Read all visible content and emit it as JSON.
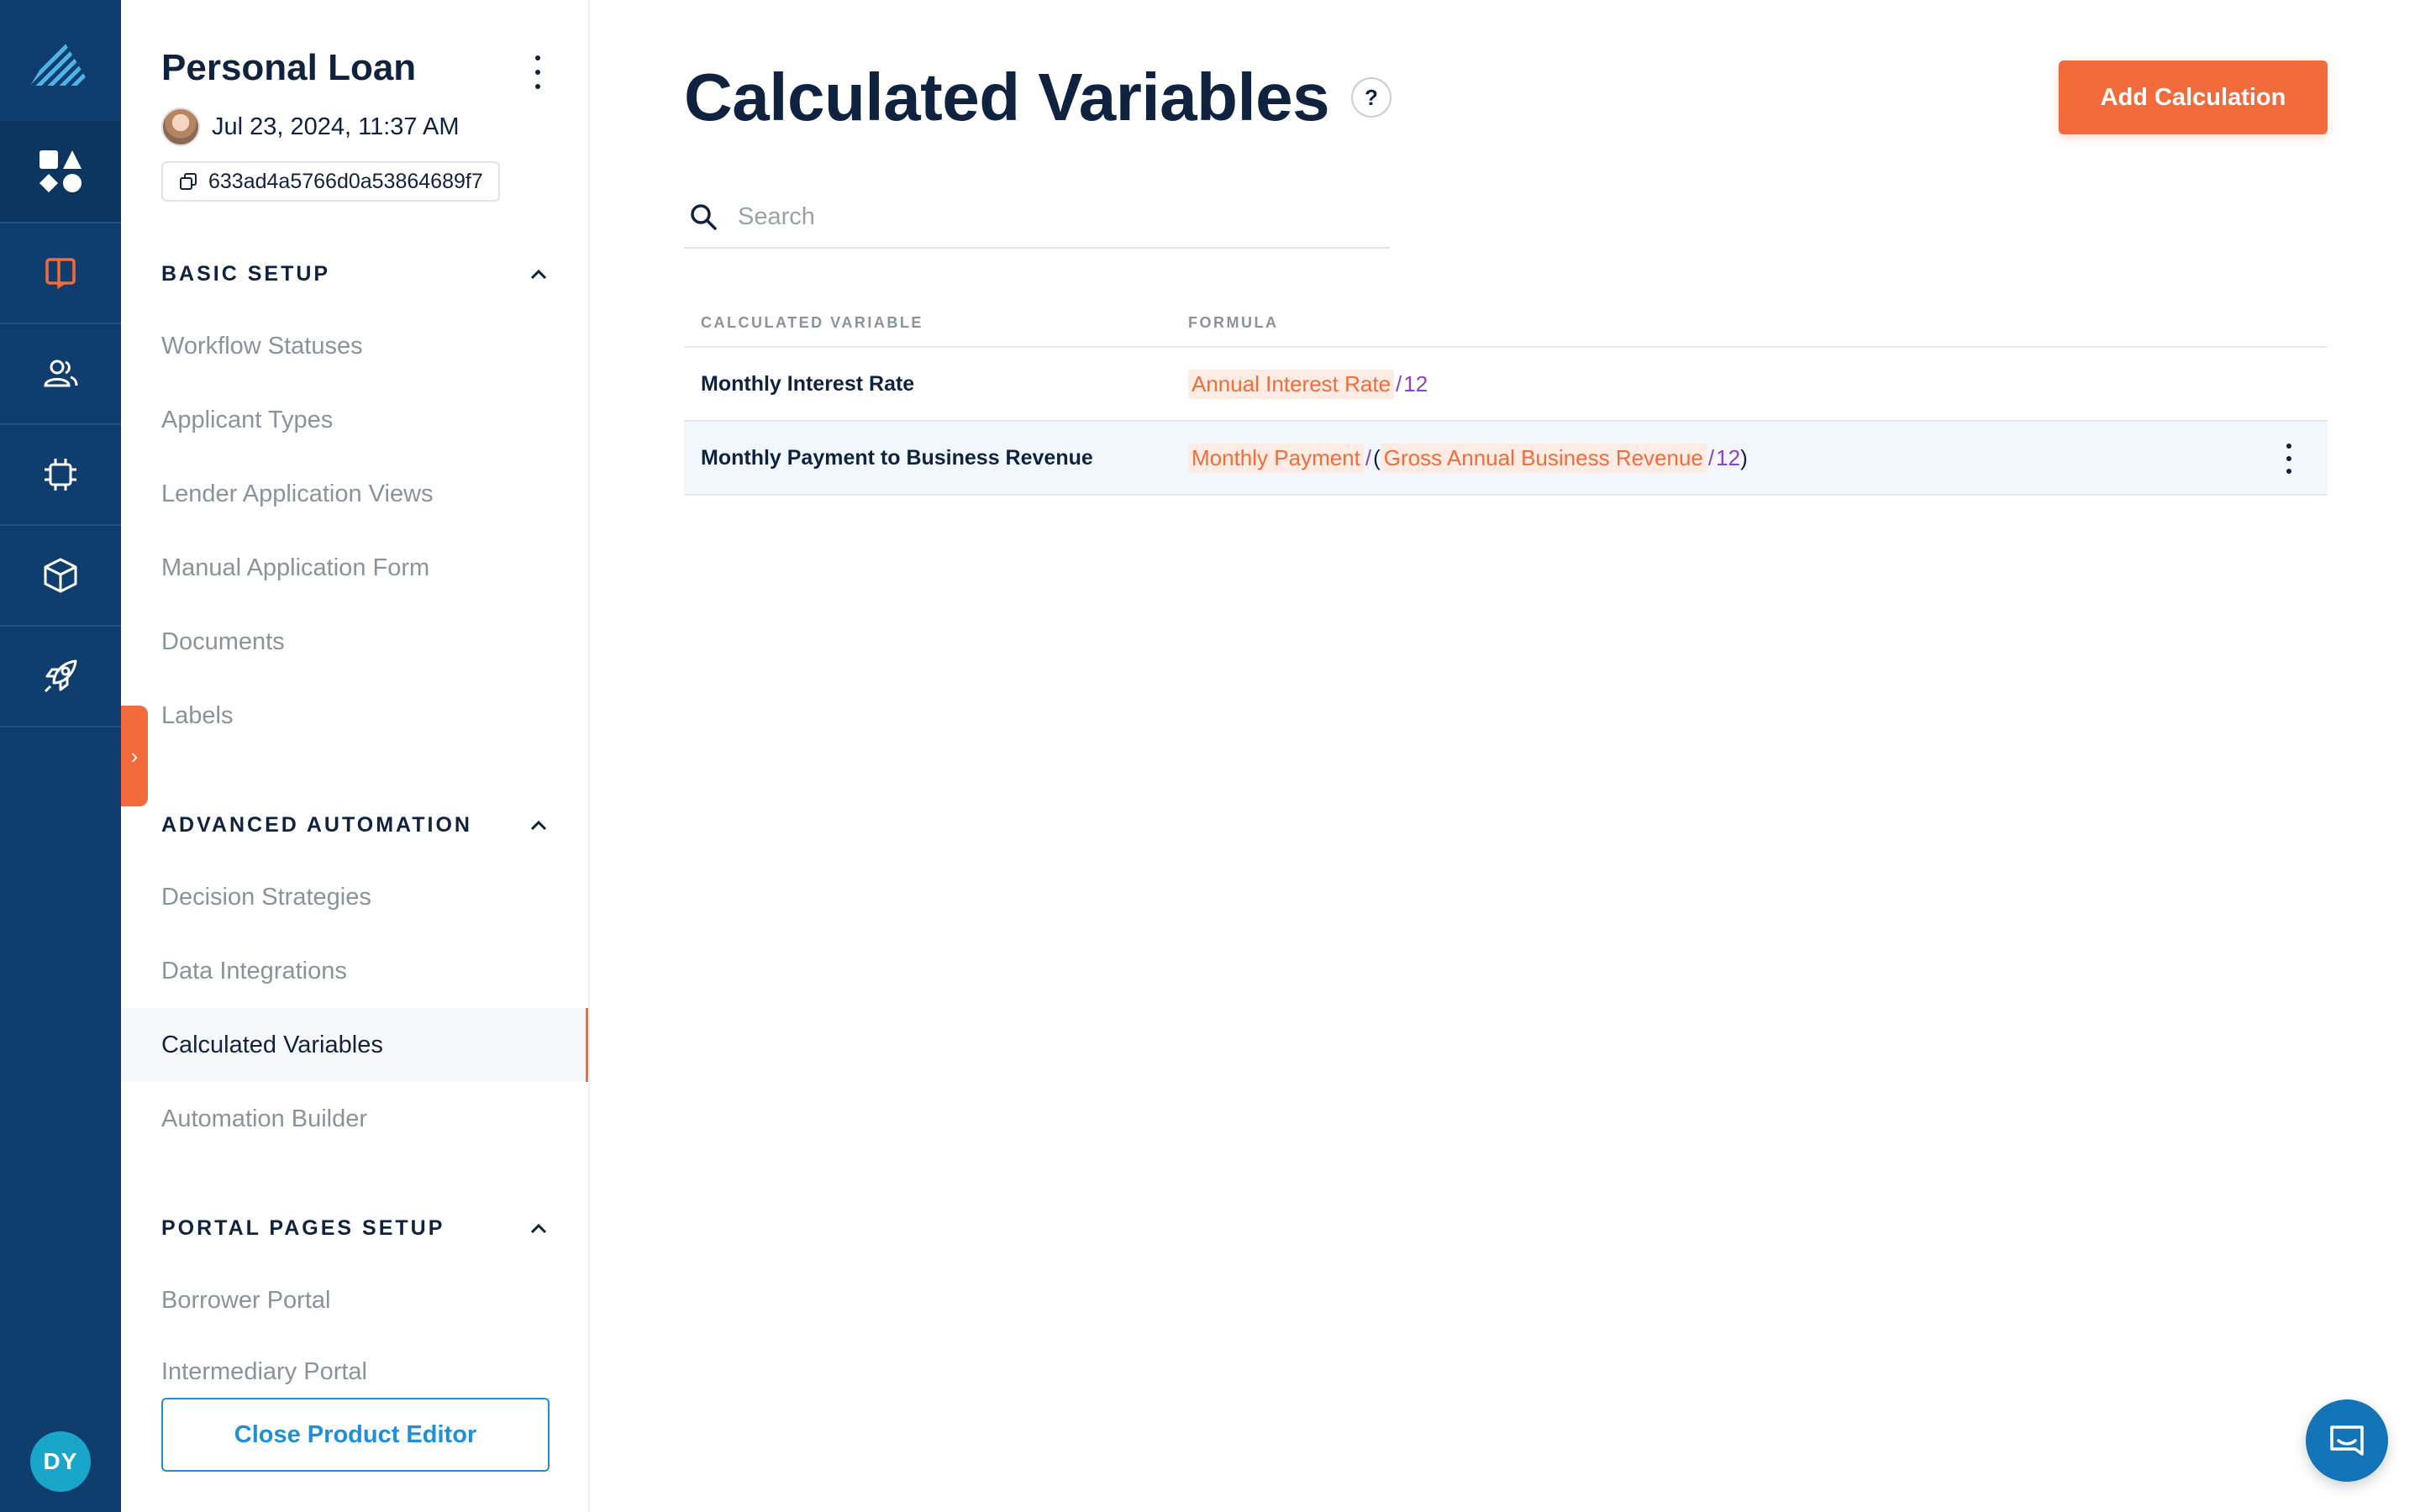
{
  "product": {
    "title": "Personal Loan",
    "date": "Jul 23, 2024, 11:37 AM",
    "id": "633ad4a5766d0a53864689f7"
  },
  "sidebar": {
    "sections": [
      {
        "label": "BASIC SETUP",
        "items": [
          "Workflow Statuses",
          "Applicant Types",
          "Lender Application Views",
          "Manual Application Form",
          "Documents",
          "Labels"
        ]
      },
      {
        "label": "ADVANCED AUTOMATION",
        "items": [
          "Decision Strategies",
          "Data Integrations",
          "Calculated Variables",
          "Automation Builder"
        ]
      },
      {
        "label": "PORTAL PAGES SETUP",
        "items": [
          "Borrower Portal",
          "Intermediary Portal"
        ]
      }
    ],
    "active_item": "Calculated Variables",
    "close_button": "Close Product Editor"
  },
  "rail": {
    "icons": [
      "logo-icon",
      "apps-icon",
      "loan-product-icon",
      "users-icon",
      "chip-icon",
      "cube-icon",
      "rocket-icon"
    ],
    "user_initials": "DY"
  },
  "main": {
    "title": "Calculated Variables",
    "help": "?",
    "add_button": "Add Calculation",
    "search_placeholder": "Search",
    "table": {
      "headers": [
        "CALCULATED VARIABLE",
        "FORMULA"
      ],
      "rows": [
        {
          "name": "Monthly Interest Rate",
          "formula": {
            "var1": "Annual Interest Rate",
            "op1": "/",
            "num1": "12"
          }
        },
        {
          "name": "Monthly Payment to Business Revenue",
          "formula": {
            "var1": "Monthly Payment",
            "op1": "/",
            "open": "(",
            "var2": "Gross Annual Business Revenue",
            "op2": "/",
            "num1": "12",
            "close": ")"
          }
        }
      ]
    }
  },
  "colors": {
    "rail": "#0f3d6e",
    "accent": "#f26b3a",
    "link": "#1f8fd8",
    "text": "#0f2340",
    "muted": "#8a929c",
    "number": "#8e3ed1"
  }
}
